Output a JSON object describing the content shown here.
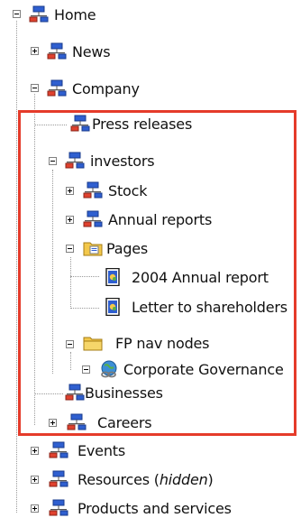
{
  "tree": {
    "items": [
      {
        "label": "Home",
        "icon": "sitemap-node-icon",
        "expander": "minus"
      },
      {
        "label": "News",
        "icon": "sitemap-node-icon",
        "expander": "plus"
      },
      {
        "label": "Company",
        "icon": "sitemap-node-icon",
        "expander": "minus"
      },
      {
        "label": "Press releases",
        "icon": "sitemap-node-icon",
        "expander": null
      },
      {
        "label": "investors",
        "icon": "sitemap-node-icon",
        "expander": "minus"
      },
      {
        "label": "Stock",
        "icon": "sitemap-node-icon",
        "expander": "plus"
      },
      {
        "label": "Annual reports",
        "icon": "sitemap-node-icon",
        "expander": "plus"
      },
      {
        "label": "Pages",
        "icon": "pages-folder-icon",
        "expander": "minus"
      },
      {
        "label": "2004 Annual report",
        "icon": "page-document-icon",
        "expander": null
      },
      {
        "label": "Letter to shareholders",
        "icon": "page-document-icon",
        "expander": null
      },
      {
        "label": "FP nav nodes",
        "icon": "folder-icon",
        "expander": "minus"
      },
      {
        "label": "Corporate Governance",
        "icon": "link-globe-icon",
        "expander": "minus"
      },
      {
        "label": "Businesses",
        "icon": "sitemap-node-icon",
        "expander": null
      },
      {
        "label": "Careers",
        "icon": "sitemap-node-icon",
        "expander": "plus"
      },
      {
        "label": "Events",
        "icon": "sitemap-node-icon",
        "expander": "plus"
      },
      {
        "label": "Resources",
        "label_suffix": "hidden",
        "icon": "sitemap-node-icon",
        "expander": "plus"
      },
      {
        "label": "Products and services",
        "icon": "sitemap-node-icon",
        "expander": "plus"
      }
    ]
  },
  "colors": {
    "highlight_border": "#e53b2a",
    "node_icon_blue": "#2f5fd0",
    "node_icon_red": "#e0412e",
    "folder_yellow": "#f3c84b"
  }
}
